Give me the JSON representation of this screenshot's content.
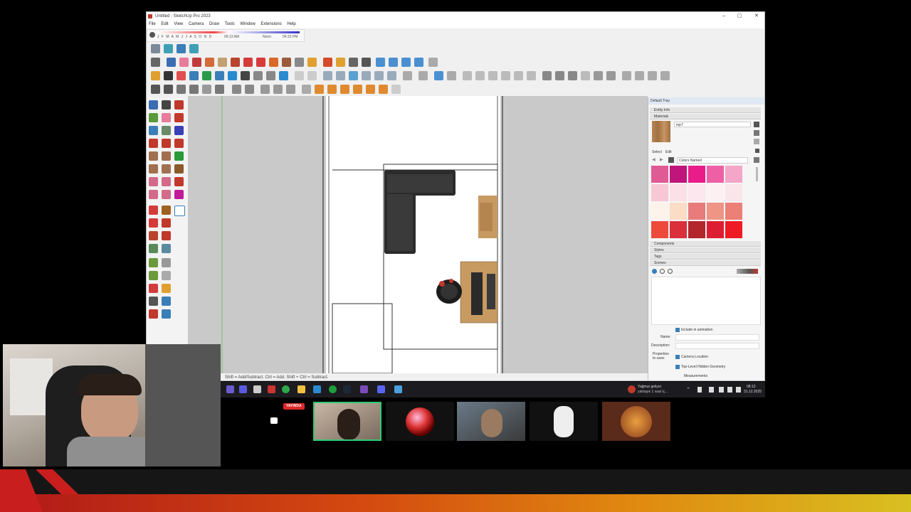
{
  "window": {
    "title": "Untitled - SketchUp Pro 2023",
    "minimize": "–",
    "maximize": "▢",
    "close": "✕"
  },
  "menu": [
    "File",
    "Edit",
    "View",
    "Camera",
    "Draw",
    "Tools",
    "Window",
    "Extensions",
    "Help"
  ],
  "shadow_bar": {
    "months": "J F M A M J J A S O N D",
    "time_start": "06:13 AM",
    "time_mid": "Noon",
    "time_end": "04:15 PM"
  },
  "status_bar": {
    "hint": "Shift = Add/Subtract. Ctrl = Add. Shift + Ctrl = Subtract."
  },
  "tray": {
    "title": "Default Tray",
    "sections": {
      "entity_info": "Entity Info",
      "materials": "Materials",
      "components": "Components",
      "styles": "Styles",
      "tags": "Tags",
      "scenes": "Scenes"
    },
    "material_name": "mp7",
    "tabs": {
      "select": "Select",
      "edit": "Edit"
    },
    "library": "Colors Named",
    "scene_fields": {
      "include_animation": "Include in animation",
      "name_label": "Name:",
      "description_label": "Description:",
      "properties_label": "Properties to save:",
      "camera_location": "Camera Location",
      "hidden_geometry": "Top-Level Hidden Geometry"
    },
    "measurements": "Measurements",
    "swatch_colors": [
      "#e05a93",
      "#c0157a",
      "#ea1c8a",
      "#ef5fa6",
      "#f4a6c8",
      "#f8c7d6",
      "#fbe0e7",
      "#fce7ee",
      "#fdf0f3",
      "#f9e5ea",
      "#fdf3ea",
      "#fbdcc4",
      "#e97b7c",
      "#ee9586",
      "#ec8077",
      "#ee4a3b",
      "#d9303a",
      "#b3262c",
      "#dd1e32",
      "#ee1b24"
    ]
  },
  "taskbar": {
    "notification": "Yağmur geliyor",
    "notification_sub": "yaklaşık 1 saat iç...",
    "time": "08:12",
    "date": "31.12.2025"
  },
  "live_badge": "YAYINDA",
  "colors": {
    "canvas_bg": "#c9c9c9",
    "floor": "#ffffff",
    "sofa": "#2b2b2b",
    "wood": "#c79a62",
    "live_red": "#e02828"
  }
}
